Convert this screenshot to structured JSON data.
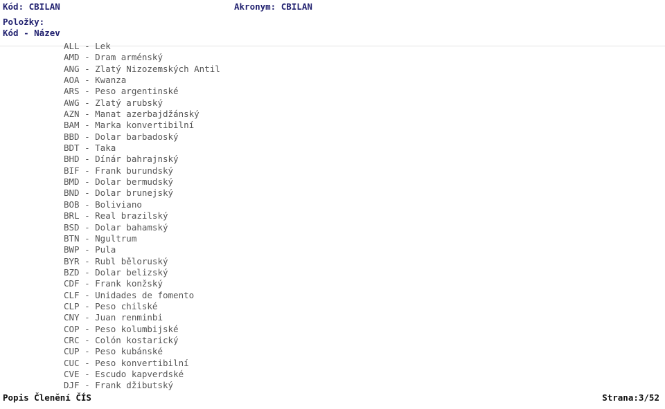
{
  "header": {
    "code_label": "Kód: CBILAN",
    "acronym_label": "Akronym: CBILAN",
    "items_label": "Položky:",
    "columns_label": "Kód - Název"
  },
  "colors": {
    "header_text": "#1f1f6e",
    "item_text": "#555555",
    "footer_text": "#111111",
    "rule": "#e2e2e2",
    "background": "#ffffff"
  },
  "items": [
    {
      "code": "ALL",
      "name": "Lek",
      "line": "ALL - Lek"
    },
    {
      "code": "AMD",
      "name": "Dram arménský",
      "line": "AMD - Dram arménský"
    },
    {
      "code": "ANG",
      "name": "Zlatý Nizozemských Antil",
      "line": "ANG - Zlatý Nizozemských Antil"
    },
    {
      "code": "AOA",
      "name": "Kwanza",
      "line": "AOA - Kwanza"
    },
    {
      "code": "ARS",
      "name": "Peso argentinské",
      "line": "ARS - Peso argentinské"
    },
    {
      "code": "AWG",
      "name": "Zlatý arubský",
      "line": "AWG - Zlatý arubský"
    },
    {
      "code": "AZN",
      "name": "Manat azerbajdžánský",
      "line": "AZN - Manat azerbajdžánský"
    },
    {
      "code": "BAM",
      "name": "Marka konvertibilní",
      "line": "BAM - Marka konvertibilní"
    },
    {
      "code": "BBD",
      "name": "Dolar barbadoský",
      "line": "BBD - Dolar barbadoský"
    },
    {
      "code": "BDT",
      "name": "Taka",
      "line": "BDT - Taka"
    },
    {
      "code": "BHD",
      "name": "Dínár bahrajnský",
      "line": "BHD - Dínár bahrajnský"
    },
    {
      "code": "BIF",
      "name": "Frank burundský",
      "line": "BIF - Frank burundský"
    },
    {
      "code": "BMD",
      "name": "Dolar bermudský",
      "line": "BMD - Dolar bermudský"
    },
    {
      "code": "BND",
      "name": "Dolar brunejský",
      "line": "BND - Dolar brunejský"
    },
    {
      "code": "BOB",
      "name": "Boliviano",
      "line": "BOB - Boliviano"
    },
    {
      "code": "BRL",
      "name": "Real brazilský",
      "line": "BRL - Real brazilský"
    },
    {
      "code": "BSD",
      "name": "Dolar bahamský",
      "line": "BSD - Dolar bahamský"
    },
    {
      "code": "BTN",
      "name": "Ngultrum",
      "line": "BTN - Ngultrum"
    },
    {
      "code": "BWP",
      "name": "Pula",
      "line": "BWP - Pula"
    },
    {
      "code": "BYR",
      "name": "Rubl běloruský",
      "line": "BYR - Rubl běloruský"
    },
    {
      "code": "BZD",
      "name": "Dolar belizský",
      "line": "BZD - Dolar belizský"
    },
    {
      "code": "CDF",
      "name": "Frank konžský",
      "line": "CDF - Frank konžský"
    },
    {
      "code": "CLF",
      "name": "Unidades de fomento",
      "line": "CLF - Unidades de fomento"
    },
    {
      "code": "CLP",
      "name": "Peso chilské",
      "line": "CLP - Peso chilské"
    },
    {
      "code": "CNY",
      "name": "Juan renminbi",
      "line": "CNY - Juan renminbi"
    },
    {
      "code": "COP",
      "name": "Peso kolumbijské",
      "line": "COP - Peso kolumbijské"
    },
    {
      "code": "CRC",
      "name": "Colón kostarický",
      "line": "CRC - Colón kostarický"
    },
    {
      "code": "CUP",
      "name": "Peso kubánské",
      "line": "CUP - Peso kubánské"
    },
    {
      "code": "CUC",
      "name": "Peso konvertibilní",
      "line": "CUC - Peso konvertibilní"
    },
    {
      "code": "CVE",
      "name": "Escudo kapverdské",
      "line": "CVE - Escudo kapverdské"
    },
    {
      "code": "DJF",
      "name": "Frank džibutský",
      "line": "DJF - Frank džibutský"
    }
  ],
  "footer": {
    "title": "Popis Členění ČÍS",
    "page_label": "Strana:3/52"
  }
}
